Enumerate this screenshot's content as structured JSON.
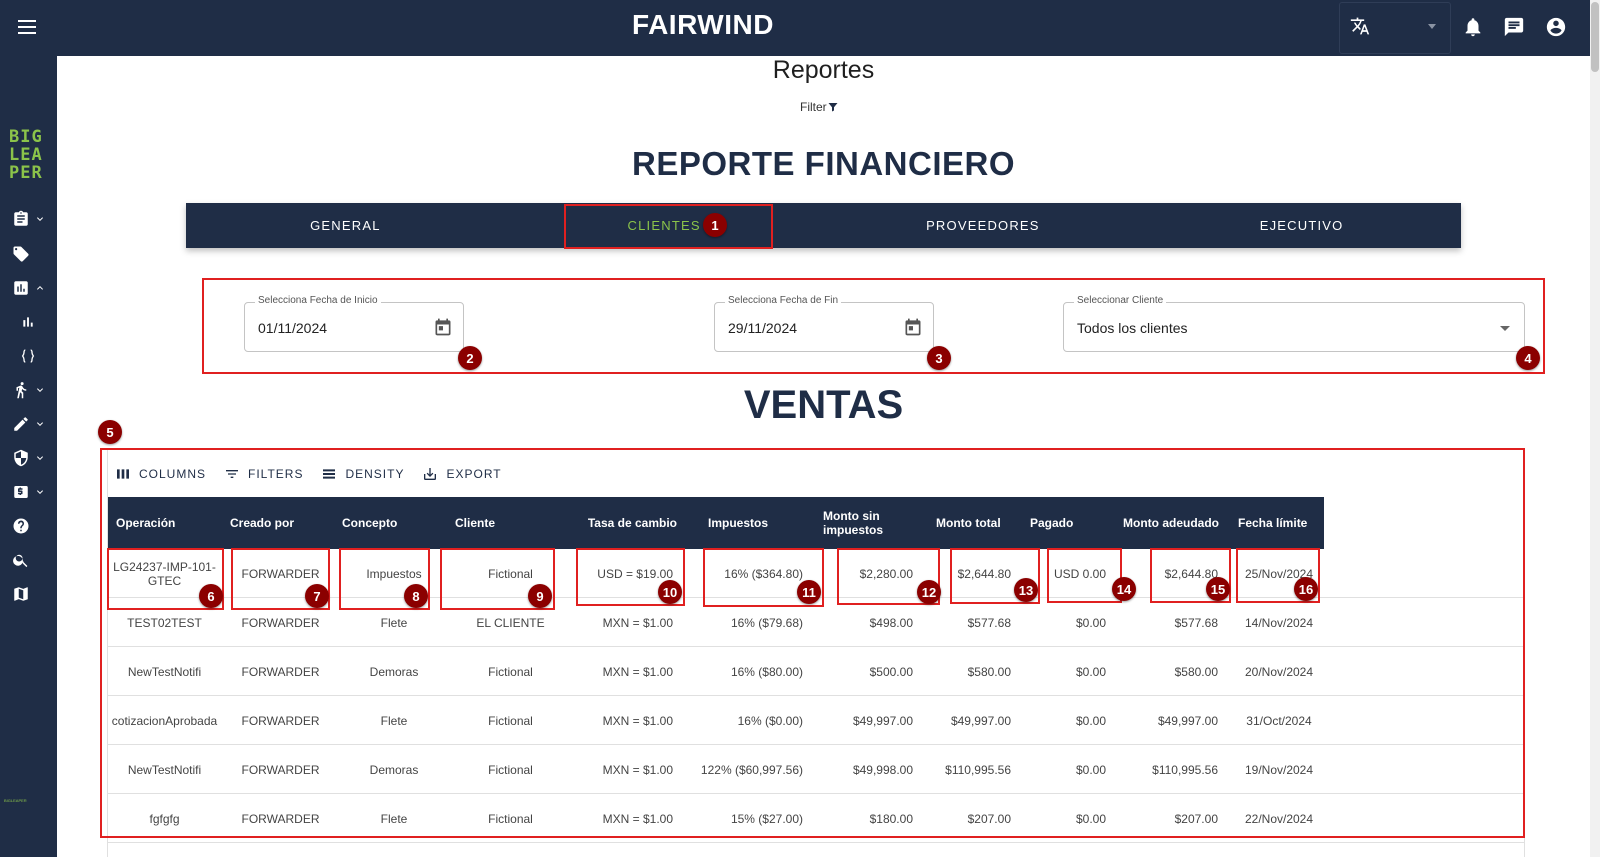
{
  "header": {
    "brand": "FAIRWIND",
    "lang_icon": "translate-icon",
    "icons": [
      "bell-icon",
      "chat-icon",
      "account-icon"
    ]
  },
  "sidebar": {
    "logo": "BIG LEA PER",
    "logo_lines": [
      "BIG",
      "LEA",
      "PER"
    ],
    "logo_small": "BIGLEAPER",
    "items": [
      "clipboard-icon",
      "tag-icon",
      "chart-box-icon",
      "bar-chart-icon",
      "code-braces-icon",
      "hiking-icon",
      "settings-pen-icon",
      "shield-settings-icon",
      "money-icon",
      "help-icon",
      "search-icon",
      "map-icon"
    ]
  },
  "page": {
    "title": "Reportes",
    "filter_label": "Filter",
    "report_title": "REPORTE FINANCIERO",
    "section_title": "VENTAS"
  },
  "tabs": [
    {
      "label": "GENERAL",
      "active": false
    },
    {
      "label": "CLIENTES",
      "active": true
    },
    {
      "label": "PROVEEDORES",
      "active": false
    },
    {
      "label": "EJECUTIVO",
      "active": false
    }
  ],
  "filters": {
    "start_date": {
      "label": "Selecciona Fecha de Inicio",
      "value": "01/11/2024"
    },
    "end_date": {
      "label": "Selecciona Fecha de Fin",
      "value": "29/11/2024"
    },
    "client": {
      "label": "Seleccionar Cliente",
      "value": "Todos los clientes"
    }
  },
  "toolbar": {
    "columns": "COLUMNS",
    "filters": "FILTERS",
    "density": "DENSITY",
    "export": "EXPORT"
  },
  "table": {
    "headers": [
      "Operación",
      "Creado por",
      "Concepto",
      "Cliente",
      "Tasa de cambio",
      "Impuestos",
      "Monto sin impuestos",
      "Monto total",
      "Pagado",
      "Monto adeudado",
      "Fecha límite"
    ],
    "rows": [
      [
        "LG24237-IMP-101-GTEC",
        "FORWARDER",
        "Impuestos",
        "Fictional",
        "USD = $19.00",
        "16% ($364.80)",
        "$2,280.00",
        "$2,644.80",
        "USD 0.00",
        "$2,644.80",
        "25/Nov/2024"
      ],
      [
        "TEST02TEST",
        "FORWARDER",
        "Flete",
        "EL CLIENTE",
        "MXN = $1.00",
        "16% ($79.68)",
        "$498.00",
        "$577.68",
        "$0.00",
        "$577.68",
        "14/Nov/2024"
      ],
      [
        "NewTestNotifi",
        "FORWARDER",
        "Demoras",
        "Fictional",
        "MXN = $1.00",
        "16% ($80.00)",
        "$500.00",
        "$580.00",
        "$0.00",
        "$580.00",
        "20/Nov/2024"
      ],
      [
        "cotizacionAprobada",
        "FORWARDER",
        "Flete",
        "Fictional",
        "MXN = $1.00",
        "16% ($0.00)",
        "$49,997.00",
        "$49,997.00",
        "$0.00",
        "$49,997.00",
        "31/Oct/2024"
      ],
      [
        "NewTestNotifi",
        "FORWARDER",
        "Demoras",
        "Fictional",
        "MXN = $1.00",
        "122% ($60,997.56)",
        "$49,998.00",
        "$110,995.56",
        "$0.00",
        "$110,995.56",
        "19/Nov/2024"
      ],
      [
        "fgfgfg",
        "FORWARDER",
        "Flete",
        "Fictional",
        "MXN = $1.00",
        "15% ($27.00)",
        "$180.00",
        "$207.00",
        "$0.00",
        "$207.00",
        "22/Nov/2024"
      ]
    ]
  },
  "annotations": [
    "1",
    "2",
    "3",
    "4",
    "5",
    "6",
    "7",
    "8",
    "9",
    "10",
    "11",
    "12",
    "13",
    "14",
    "15",
    "16"
  ],
  "colors": {
    "navy": "#1f2d46",
    "accent_green": "#8bc34a",
    "annotation_red": "#e02020",
    "badge": "#8b0000"
  }
}
